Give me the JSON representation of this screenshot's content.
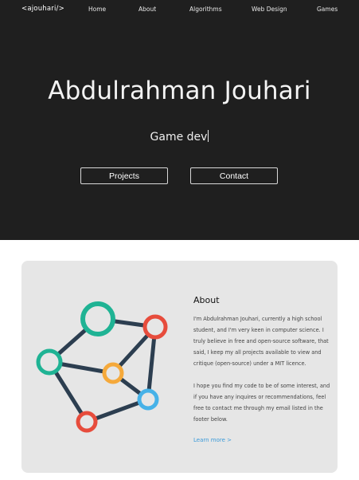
{
  "nav": {
    "brand": "<ajouhari/>",
    "items": [
      {
        "label": "Home"
      },
      {
        "label": "About"
      },
      {
        "label": "Algorithms"
      },
      {
        "label": "Web Design"
      },
      {
        "label": "Games"
      }
    ]
  },
  "hero": {
    "name": "Abdulrahman Jouhari",
    "typed_text": "Game dev",
    "buttons": {
      "projects": "Projects",
      "contact": "Contact"
    }
  },
  "about": {
    "title": "About",
    "paragraph1": "I'm Abdulrahman Jouhari, currently a high school student, and I'm very keen in computer science. I truly believe in free and open-source software, that said, I keep my all projects available to view and critique (open-source) under a MIT licence.",
    "paragraph2": "I hope you find my code to be of some interest, and if you have any inquires or recommendations, feel free to contact me through my email listed in the footer below.",
    "learn_more": "Learn more >"
  },
  "colors": {
    "hero_bg": "#1f1f1f",
    "card_bg": "#e6e6e6",
    "link": "#3a9ad9",
    "graph_edge": "#2c3e50",
    "node_teal": "#1fb394",
    "node_red": "#e74c3c",
    "node_orange": "#f5a93b",
    "node_blue": "#47b2e8"
  }
}
